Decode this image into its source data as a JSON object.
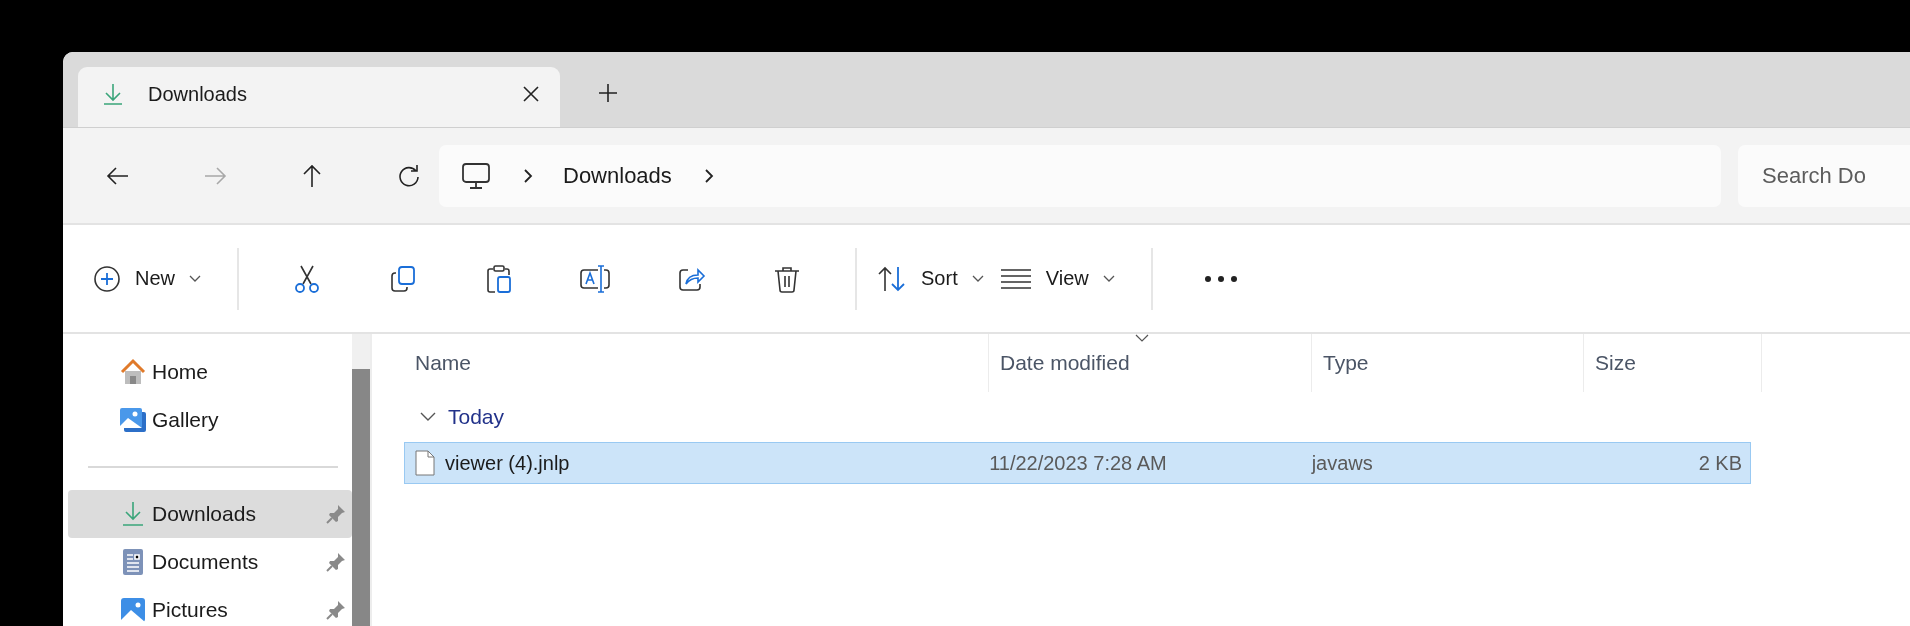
{
  "tabs": [
    {
      "title": "Downloads",
      "selected": true
    }
  ],
  "nav_buttons": [
    {
      "kind": "back",
      "disabled": false
    },
    {
      "kind": "forward",
      "disabled": true
    },
    {
      "kind": "up",
      "disabled": false
    },
    {
      "kind": "refresh",
      "disabled": false
    }
  ],
  "breadcrumb": [
    "Downloads"
  ],
  "search": {
    "placeholder": "Search Do"
  },
  "toolbar": {
    "new_label": "New",
    "sort_label": "Sort",
    "view_label": "View"
  },
  "sidebar": {
    "items": [
      {
        "label": "Home",
        "kind": "home",
        "pinned": false,
        "selected": false
      },
      {
        "label": "Gallery",
        "kind": "gallery",
        "pinned": false,
        "selected": false
      },
      {
        "label": "Downloads",
        "kind": "downloads",
        "pinned": true,
        "selected": true
      },
      {
        "label": "Documents",
        "kind": "documents",
        "pinned": true,
        "selected": false
      },
      {
        "label": "Pictures",
        "kind": "pictures",
        "pinned": true,
        "selected": false
      }
    ]
  },
  "table": {
    "columns": [
      {
        "label": "Name",
        "sorted": false
      },
      {
        "label": "Date modified",
        "sorted": true
      },
      {
        "label": "Type",
        "sorted": false
      },
      {
        "label": "Size",
        "sorted": false
      }
    ],
    "groups": [
      {
        "label": "Today",
        "expanded": true,
        "rows": [
          {
            "name": "viewer (4).jnlp",
            "date": "11/22/2023 7:28 AM",
            "type": "javaws",
            "size": "2 KB",
            "selected": true
          }
        ]
      }
    ]
  }
}
